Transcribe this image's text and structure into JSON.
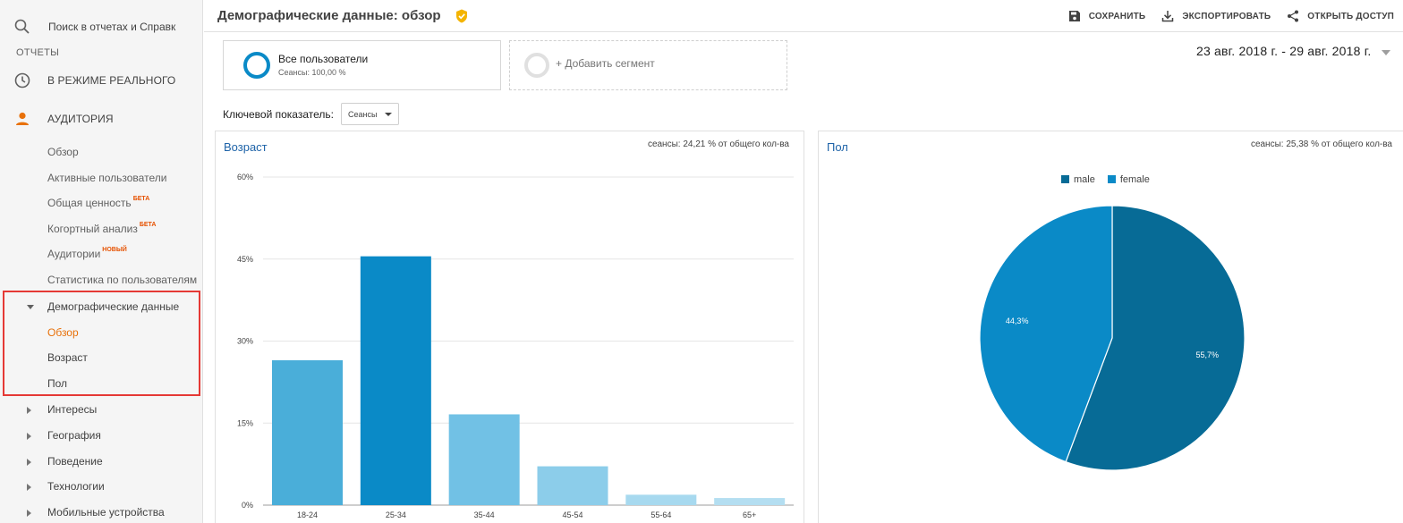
{
  "sidebar": {
    "search_placeholder": "Поиск в отчетах и Справк",
    "section_label": "ОТЧЕТЫ",
    "realtime_label": "В РЕЖИМЕ РЕАЛЬНОГО",
    "audience_label": "АУДИТОРИЯ",
    "audience_items": [
      {
        "label": "Обзор",
        "badge": ""
      },
      {
        "label": "Активные пользователи",
        "badge": ""
      },
      {
        "label": "Общая ценность",
        "badge": "БЕТА"
      },
      {
        "label": "Когортный анализ",
        "badge": "БЕТА"
      },
      {
        "label": "Аудитории",
        "badge": "НОВЫЙ"
      },
      {
        "label": "Статистика по пользователям",
        "badge": ""
      }
    ],
    "demographics": {
      "label": "Демографические данные",
      "items": [
        "Обзор",
        "Возраст",
        "Пол"
      ],
      "active_item": "Обзор"
    },
    "collapsed_groups": [
      "Интересы",
      "География",
      "Поведение",
      "Технологии",
      "Мобильные устройства"
    ]
  },
  "header": {
    "title": "Демографические данные: обзор",
    "actions": [
      {
        "label": "СОХРАНИТЬ",
        "icon": "save-icon"
      },
      {
        "label": "ЭКСПОРТИРОВАТЬ",
        "icon": "download-icon"
      },
      {
        "label": "ОТКРЫТЬ ДОСТУП",
        "icon": "share-icon"
      }
    ]
  },
  "segments": {
    "active": {
      "name": "Все пользователи",
      "meta": "Сеансы: 100,00 %"
    },
    "add_label": "+ Добавить сегмент"
  },
  "date_range": "23 авг. 2018 г. - 29 авг. 2018 г.",
  "kpi": {
    "label": "Ключевой показатель:",
    "value": "Сеансы"
  },
  "age_panel": {
    "title": "Возраст",
    "meta": "сеансы: 24,21 % от общего кол-ва"
  },
  "gender_panel": {
    "title": "Пол",
    "meta": "сеансы: 25,38 % от общего кол-ва"
  },
  "colors": {
    "accent": "#e8710a",
    "link_blue": "#1e63a8",
    "male": "#076b96",
    "female": "#0a8ac7",
    "age_bars": [
      "#4aaed9",
      "#0a8ac7",
      "#71c1e5",
      "#8ccdea",
      "#a7d9ef",
      "#b4def1"
    ]
  },
  "chart_data": [
    {
      "type": "bar",
      "title": "Возраст",
      "categories": [
        "18-24",
        "25-34",
        "35-44",
        "45-54",
        "55-64",
        "65+"
      ],
      "values": [
        26.5,
        45.5,
        16.6,
        7.1,
        1.9,
        1.3
      ],
      "yticks": [
        "0%",
        "15%",
        "30%",
        "45%",
        "60%"
      ],
      "ylim": [
        0,
        60
      ],
      "grid": true
    },
    {
      "type": "pie",
      "title": "Пол",
      "categories": [
        "male",
        "female"
      ],
      "values": [
        55.7,
        44.3
      ],
      "labels": [
        "55,7%",
        "44,3%"
      ],
      "legend": "top"
    }
  ]
}
